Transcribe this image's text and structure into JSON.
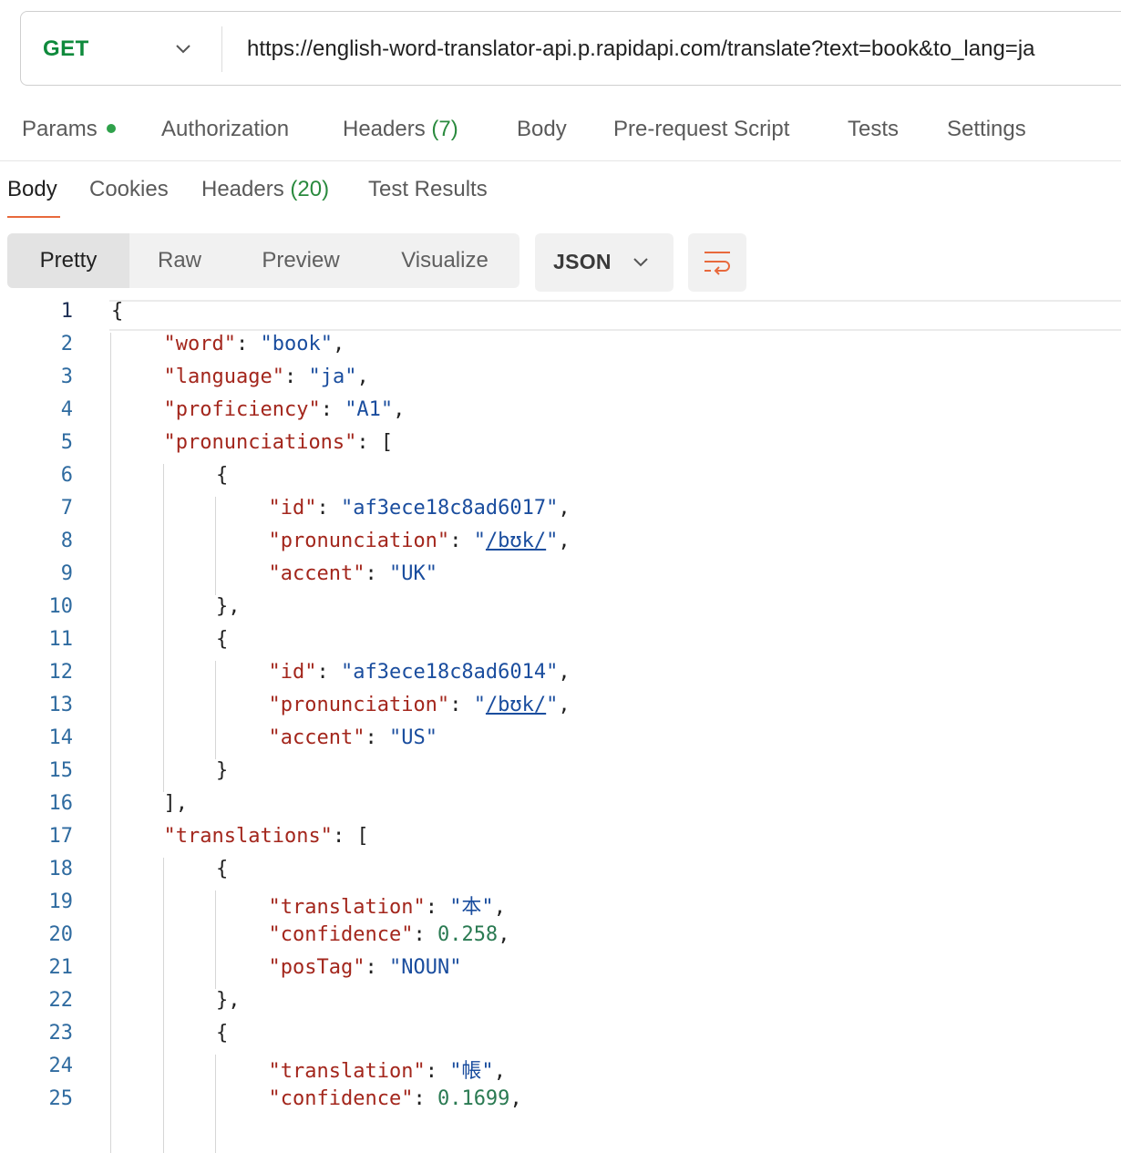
{
  "request": {
    "method": "GET",
    "url": "https://english-word-translator-api.p.rapidapi.com/translate?text=book&to_lang=ja"
  },
  "request_tabs": {
    "params": "Params",
    "authorization": "Authorization",
    "headers": "Headers",
    "headers_count": "(7)",
    "body": "Body",
    "prerequest": "Pre-request Script",
    "tests": "Tests",
    "settings": "Settings"
  },
  "response_tabs": {
    "body": "Body",
    "cookies": "Cookies",
    "headers": "Headers",
    "headers_count": "(20)",
    "test_results": "Test Results"
  },
  "view_modes": {
    "pretty": "Pretty",
    "raw": "Raw",
    "preview": "Preview",
    "visualize": "Visualize"
  },
  "format": "JSON",
  "icons": {
    "method_dropdown": "chevron-down-icon",
    "params_status": "green-dot-icon",
    "format_dropdown": "chevron-down-icon",
    "wrap": "wrap-lines-icon"
  },
  "colors": {
    "method": "#0f8a3c",
    "accent": "#e8693c",
    "key": "#a3261c",
    "string": "#1a4d9e",
    "number": "#2a7a52"
  },
  "code_lines": [
    {
      "n": "1",
      "indent": 0,
      "parts": [
        {
          "t": "p",
          "v": "{"
        }
      ]
    },
    {
      "n": "2",
      "indent": 1,
      "parts": [
        {
          "t": "k",
          "v": "\"word\""
        },
        {
          "t": "p",
          "v": ": "
        },
        {
          "t": "s",
          "v": "\"book\""
        },
        {
          "t": "p",
          "v": ","
        }
      ]
    },
    {
      "n": "3",
      "indent": 1,
      "parts": [
        {
          "t": "k",
          "v": "\"language\""
        },
        {
          "t": "p",
          "v": ": "
        },
        {
          "t": "s",
          "v": "\"ja\""
        },
        {
          "t": "p",
          "v": ","
        }
      ]
    },
    {
      "n": "4",
      "indent": 1,
      "parts": [
        {
          "t": "k",
          "v": "\"proficiency\""
        },
        {
          "t": "p",
          "v": ": "
        },
        {
          "t": "s",
          "v": "\"A1\""
        },
        {
          "t": "p",
          "v": ","
        }
      ]
    },
    {
      "n": "5",
      "indent": 1,
      "parts": [
        {
          "t": "k",
          "v": "\"pronunciations\""
        },
        {
          "t": "p",
          "v": ": ["
        }
      ]
    },
    {
      "n": "6",
      "indent": 2,
      "parts": [
        {
          "t": "p",
          "v": "{"
        }
      ]
    },
    {
      "n": "7",
      "indent": 3,
      "parts": [
        {
          "t": "k",
          "v": "\"id\""
        },
        {
          "t": "p",
          "v": ": "
        },
        {
          "t": "s",
          "v": "\"af3ece18c8ad6017\""
        },
        {
          "t": "p",
          "v": ","
        }
      ]
    },
    {
      "n": "8",
      "indent": 3,
      "parts": [
        {
          "t": "k",
          "v": "\"pronunciation\""
        },
        {
          "t": "p",
          "v": ": "
        },
        {
          "t": "s",
          "v": "\""
        },
        {
          "t": "u",
          "v": "/bʊk/"
        },
        {
          "t": "s",
          "v": "\""
        },
        {
          "t": "p",
          "v": ","
        }
      ]
    },
    {
      "n": "9",
      "indent": 3,
      "parts": [
        {
          "t": "k",
          "v": "\"accent\""
        },
        {
          "t": "p",
          "v": ": "
        },
        {
          "t": "s",
          "v": "\"UK\""
        }
      ]
    },
    {
      "n": "10",
      "indent": 2,
      "parts": [
        {
          "t": "p",
          "v": "},"
        }
      ]
    },
    {
      "n": "11",
      "indent": 2,
      "parts": [
        {
          "t": "p",
          "v": "{"
        }
      ]
    },
    {
      "n": "12",
      "indent": 3,
      "parts": [
        {
          "t": "k",
          "v": "\"id\""
        },
        {
          "t": "p",
          "v": ": "
        },
        {
          "t": "s",
          "v": "\"af3ece18c8ad6014\""
        },
        {
          "t": "p",
          "v": ","
        }
      ]
    },
    {
      "n": "13",
      "indent": 3,
      "parts": [
        {
          "t": "k",
          "v": "\"pronunciation\""
        },
        {
          "t": "p",
          "v": ": "
        },
        {
          "t": "s",
          "v": "\""
        },
        {
          "t": "u",
          "v": "/bʊk/"
        },
        {
          "t": "s",
          "v": "\""
        },
        {
          "t": "p",
          "v": ","
        }
      ]
    },
    {
      "n": "14",
      "indent": 3,
      "parts": [
        {
          "t": "k",
          "v": "\"accent\""
        },
        {
          "t": "p",
          "v": ": "
        },
        {
          "t": "s",
          "v": "\"US\""
        }
      ]
    },
    {
      "n": "15",
      "indent": 2,
      "parts": [
        {
          "t": "p",
          "v": "}"
        }
      ]
    },
    {
      "n": "16",
      "indent": 1,
      "parts": [
        {
          "t": "p",
          "v": "],"
        }
      ]
    },
    {
      "n": "17",
      "indent": 1,
      "parts": [
        {
          "t": "k",
          "v": "\"translations\""
        },
        {
          "t": "p",
          "v": ": ["
        }
      ]
    },
    {
      "n": "18",
      "indent": 2,
      "parts": [
        {
          "t": "p",
          "v": "{"
        }
      ]
    },
    {
      "n": "19",
      "indent": 3,
      "parts": [
        {
          "t": "k",
          "v": "\"translation\""
        },
        {
          "t": "p",
          "v": ": "
        },
        {
          "t": "s",
          "v": "\"本\""
        },
        {
          "t": "p",
          "v": ","
        }
      ]
    },
    {
      "n": "20",
      "indent": 3,
      "parts": [
        {
          "t": "k",
          "v": "\"confidence\""
        },
        {
          "t": "p",
          "v": ": "
        },
        {
          "t": "n",
          "v": "0.258"
        },
        {
          "t": "p",
          "v": ","
        }
      ]
    },
    {
      "n": "21",
      "indent": 3,
      "parts": [
        {
          "t": "k",
          "v": "\"posTag\""
        },
        {
          "t": "p",
          "v": ": "
        },
        {
          "t": "s",
          "v": "\"NOUN\""
        }
      ]
    },
    {
      "n": "22",
      "indent": 2,
      "parts": [
        {
          "t": "p",
          "v": "},"
        }
      ]
    },
    {
      "n": "23",
      "indent": 2,
      "parts": [
        {
          "t": "p",
          "v": "{"
        }
      ]
    },
    {
      "n": "24",
      "indent": 3,
      "parts": [
        {
          "t": "k",
          "v": "\"translation\""
        },
        {
          "t": "p",
          "v": ": "
        },
        {
          "t": "s",
          "v": "\"帳\""
        },
        {
          "t": "p",
          "v": ","
        }
      ]
    },
    {
      "n": "25",
      "indent": 3,
      "parts": [
        {
          "t": "k",
          "v": "\"confidence\""
        },
        {
          "t": "p",
          "v": ": "
        },
        {
          "t": "n",
          "v": "0.1699"
        },
        {
          "t": "p",
          "v": ","
        }
      ]
    }
  ]
}
